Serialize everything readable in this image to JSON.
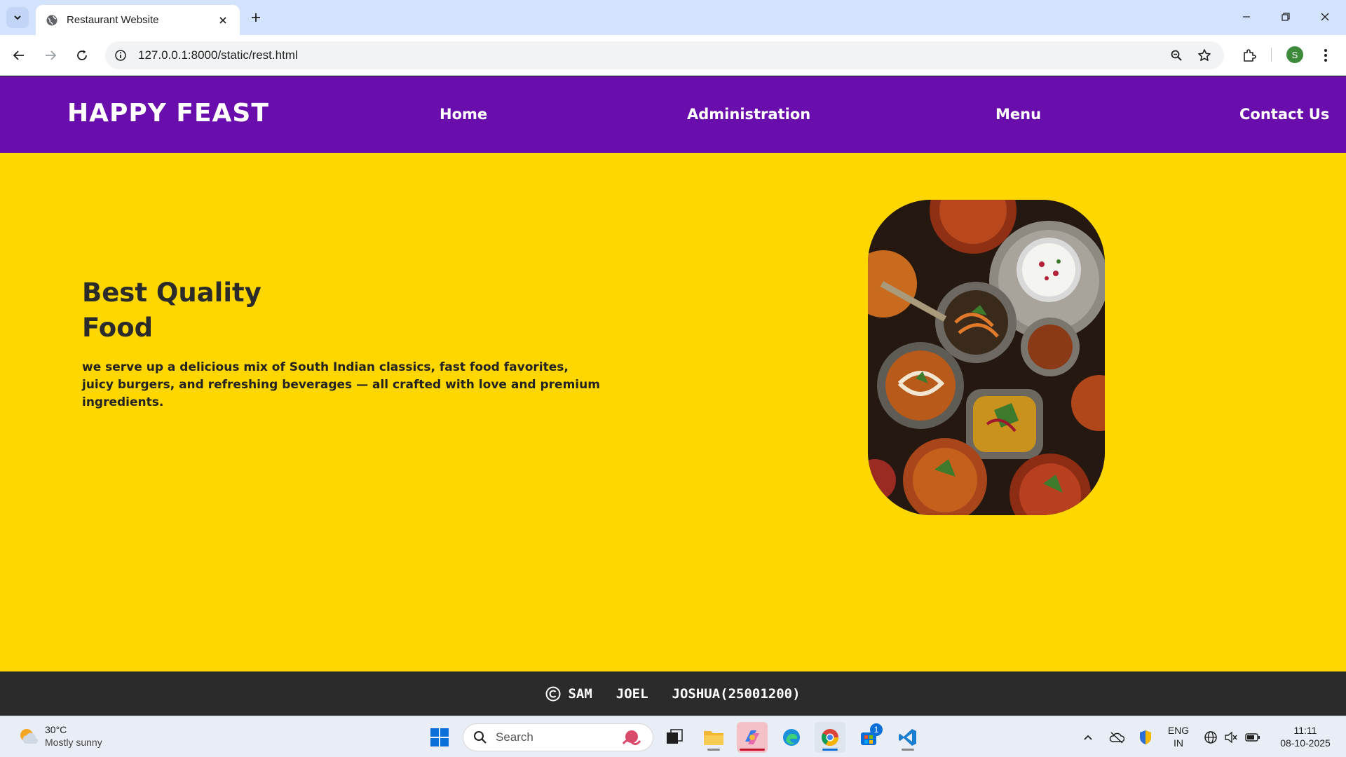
{
  "browser": {
    "tab_title": "Restaurant Website",
    "url": "127.0.0.1:8000/static/rest.html",
    "profile_initial": "S"
  },
  "site": {
    "logo": "HAPPY FEAST",
    "nav": [
      "Home",
      "Administration",
      "Menu",
      "Contact Us"
    ],
    "hero": {
      "title_line1": "Best Quality",
      "title_line2": "Food",
      "text_line1": "we serve up a delicious mix of South Indian classics, fast food favorites,",
      "text_line2": "juicy burgers, and refreshing beverages — all crafted with love and premium ingredients."
    },
    "footer": [
      "SAM",
      "JOEL",
      "JOSHUA(25001200)"
    ],
    "colors": {
      "nav_bg": "#6a0dad",
      "hero_bg": "#ffd700",
      "footer_bg": "#2b2b2b"
    }
  },
  "taskbar": {
    "weather_temp": "30°C",
    "weather_desc": "Mostly sunny",
    "search_placeholder": "Search",
    "lang_line1": "ENG",
    "lang_line2": "IN",
    "time": "11:11",
    "date": "08-10-2025",
    "store_badge": "1"
  }
}
